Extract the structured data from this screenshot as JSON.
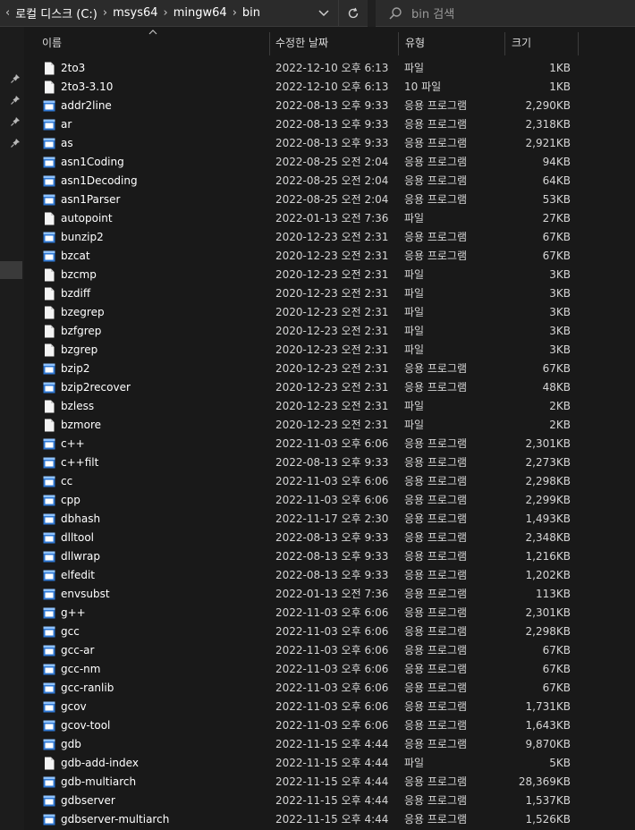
{
  "address": {
    "crumbs": [
      "로컬 디스크 (C:)",
      "msys64",
      "mingw64",
      "bin"
    ],
    "search_placeholder": "bin 검색"
  },
  "columns": {
    "name": "이름",
    "date": "수정한 날짜",
    "type": "유형",
    "size": "크기"
  },
  "files": [
    {
      "name": "2to3",
      "date": "2022-12-10 오후 6:13",
      "type": "파일",
      "size": "1KB",
      "icon": "file-icon"
    },
    {
      "name": "2to3-3.10",
      "date": "2022-12-10 오후 6:13",
      "type": "10 파일",
      "size": "1KB",
      "icon": "file-icon"
    },
    {
      "name": "addr2line",
      "date": "2022-08-13 오후 9:33",
      "type": "응용 프로그램",
      "size": "2,290KB",
      "icon": "app-icon"
    },
    {
      "name": "ar",
      "date": "2022-08-13 오후 9:33",
      "type": "응용 프로그램",
      "size": "2,318KB",
      "icon": "app-icon"
    },
    {
      "name": "as",
      "date": "2022-08-13 오후 9:33",
      "type": "응용 프로그램",
      "size": "2,921KB",
      "icon": "app-icon"
    },
    {
      "name": "asn1Coding",
      "date": "2022-08-25 오전 2:04",
      "type": "응용 프로그램",
      "size": "94KB",
      "icon": "app-icon"
    },
    {
      "name": "asn1Decoding",
      "date": "2022-08-25 오전 2:04",
      "type": "응용 프로그램",
      "size": "64KB",
      "icon": "app-icon"
    },
    {
      "name": "asn1Parser",
      "date": "2022-08-25 오전 2:04",
      "type": "응용 프로그램",
      "size": "53KB",
      "icon": "app-icon"
    },
    {
      "name": "autopoint",
      "date": "2022-01-13 오전 7:36",
      "type": "파일",
      "size": "27KB",
      "icon": "file-icon"
    },
    {
      "name": "bunzip2",
      "date": "2020-12-23 오전 2:31",
      "type": "응용 프로그램",
      "size": "67KB",
      "icon": "app-icon"
    },
    {
      "name": "bzcat",
      "date": "2020-12-23 오전 2:31",
      "type": "응용 프로그램",
      "size": "67KB",
      "icon": "app-icon"
    },
    {
      "name": "bzcmp",
      "date": "2020-12-23 오전 2:31",
      "type": "파일",
      "size": "3KB",
      "icon": "file-icon"
    },
    {
      "name": "bzdiff",
      "date": "2020-12-23 오전 2:31",
      "type": "파일",
      "size": "3KB",
      "icon": "file-icon"
    },
    {
      "name": "bzegrep",
      "date": "2020-12-23 오전 2:31",
      "type": "파일",
      "size": "3KB",
      "icon": "file-icon"
    },
    {
      "name": "bzfgrep",
      "date": "2020-12-23 오전 2:31",
      "type": "파일",
      "size": "3KB",
      "icon": "file-icon"
    },
    {
      "name": "bzgrep",
      "date": "2020-12-23 오전 2:31",
      "type": "파일",
      "size": "3KB",
      "icon": "file-icon"
    },
    {
      "name": "bzip2",
      "date": "2020-12-23 오전 2:31",
      "type": "응용 프로그램",
      "size": "67KB",
      "icon": "app-icon"
    },
    {
      "name": "bzip2recover",
      "date": "2020-12-23 오전 2:31",
      "type": "응용 프로그램",
      "size": "48KB",
      "icon": "app-icon"
    },
    {
      "name": "bzless",
      "date": "2020-12-23 오전 2:31",
      "type": "파일",
      "size": "2KB",
      "icon": "file-icon"
    },
    {
      "name": "bzmore",
      "date": "2020-12-23 오전 2:31",
      "type": "파일",
      "size": "2KB",
      "icon": "file-icon"
    },
    {
      "name": "c++",
      "date": "2022-11-03 오후 6:06",
      "type": "응용 프로그램",
      "size": "2,301KB",
      "icon": "app-icon"
    },
    {
      "name": "c++filt",
      "date": "2022-08-13 오후 9:33",
      "type": "응용 프로그램",
      "size": "2,273KB",
      "icon": "app-icon"
    },
    {
      "name": "cc",
      "date": "2022-11-03 오후 6:06",
      "type": "응용 프로그램",
      "size": "2,298KB",
      "icon": "app-icon"
    },
    {
      "name": "cpp",
      "date": "2022-11-03 오후 6:06",
      "type": "응용 프로그램",
      "size": "2,299KB",
      "icon": "app-icon"
    },
    {
      "name": "dbhash",
      "date": "2022-11-17 오후 2:30",
      "type": "응용 프로그램",
      "size": "1,493KB",
      "icon": "app-icon"
    },
    {
      "name": "dlltool",
      "date": "2022-08-13 오후 9:33",
      "type": "응용 프로그램",
      "size": "2,348KB",
      "icon": "app-icon"
    },
    {
      "name": "dllwrap",
      "date": "2022-08-13 오후 9:33",
      "type": "응용 프로그램",
      "size": "1,216KB",
      "icon": "app-icon"
    },
    {
      "name": "elfedit",
      "date": "2022-08-13 오후 9:33",
      "type": "응용 프로그램",
      "size": "1,202KB",
      "icon": "app-icon"
    },
    {
      "name": "envsubst",
      "date": "2022-01-13 오전 7:36",
      "type": "응용 프로그램",
      "size": "113KB",
      "icon": "app-icon"
    },
    {
      "name": "g++",
      "date": "2022-11-03 오후 6:06",
      "type": "응용 프로그램",
      "size": "2,301KB",
      "icon": "app-icon"
    },
    {
      "name": "gcc",
      "date": "2022-11-03 오후 6:06",
      "type": "응용 프로그램",
      "size": "2,298KB",
      "icon": "app-icon"
    },
    {
      "name": "gcc-ar",
      "date": "2022-11-03 오후 6:06",
      "type": "응용 프로그램",
      "size": "67KB",
      "icon": "app-icon"
    },
    {
      "name": "gcc-nm",
      "date": "2022-11-03 오후 6:06",
      "type": "응용 프로그램",
      "size": "67KB",
      "icon": "app-icon"
    },
    {
      "name": "gcc-ranlib",
      "date": "2022-11-03 오후 6:06",
      "type": "응용 프로그램",
      "size": "67KB",
      "icon": "app-icon"
    },
    {
      "name": "gcov",
      "date": "2022-11-03 오후 6:06",
      "type": "응용 프로그램",
      "size": "1,731KB",
      "icon": "app-icon"
    },
    {
      "name": "gcov-tool",
      "date": "2022-11-03 오후 6:06",
      "type": "응용 프로그램",
      "size": "1,643KB",
      "icon": "app-icon"
    },
    {
      "name": "gdb",
      "date": "2022-11-15 오후 4:44",
      "type": "응용 프로그램",
      "size": "9,870KB",
      "icon": "app-icon"
    },
    {
      "name": "gdb-add-index",
      "date": "2022-11-15 오후 4:44",
      "type": "파일",
      "size": "5KB",
      "icon": "file-icon"
    },
    {
      "name": "gdb-multiarch",
      "date": "2022-11-15 오후 4:44",
      "type": "응용 프로그램",
      "size": "28,369KB",
      "icon": "app-icon"
    },
    {
      "name": "gdbserver",
      "date": "2022-11-15 오후 4:44",
      "type": "응용 프로그램",
      "size": "1,537KB",
      "icon": "app-icon"
    },
    {
      "name": "gdbserver-multiarch",
      "date": "2022-11-15 오후 4:44",
      "type": "응용 프로그램",
      "size": "1,526KB",
      "icon": "app-icon"
    }
  ]
}
